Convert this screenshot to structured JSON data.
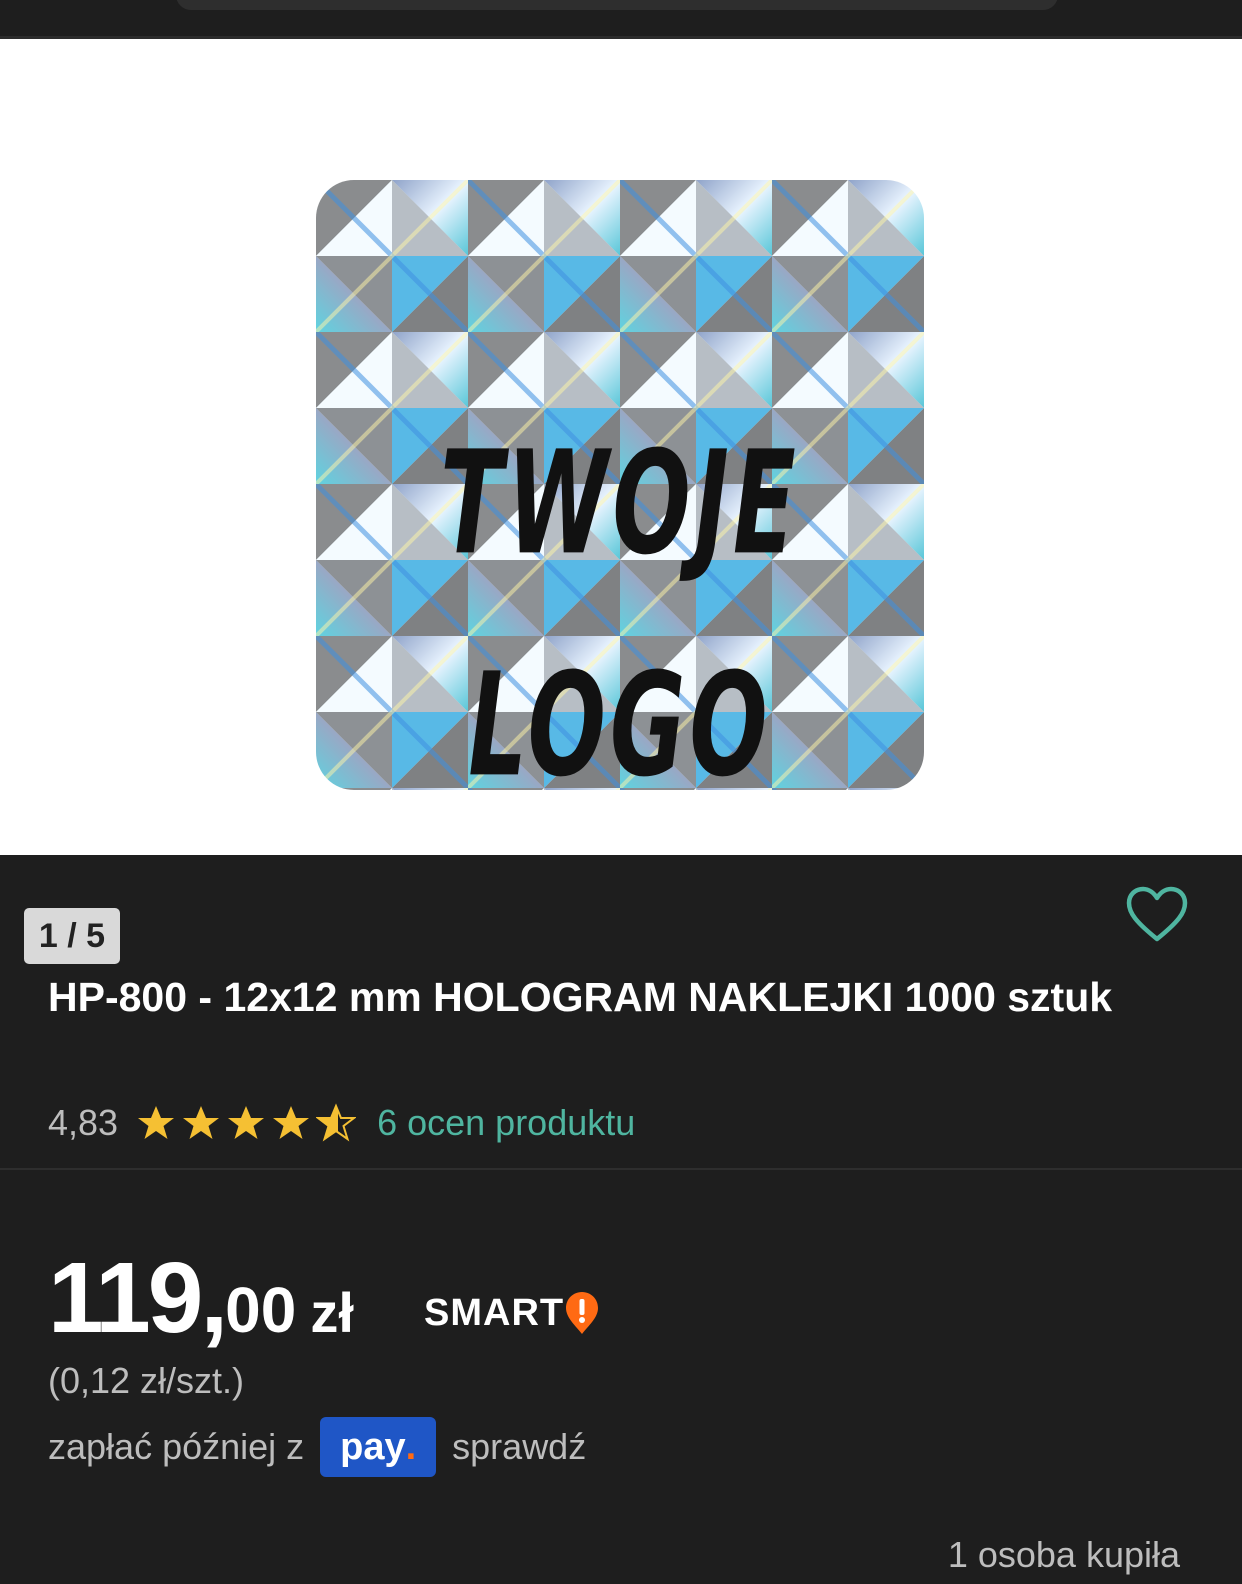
{
  "gallery": {
    "image_text_line1": "TWOJE",
    "image_text_line2": "LOGO",
    "counter": "1 / 5"
  },
  "product": {
    "title": "HP-800 - 12x12 mm HOLOGRAM NAKLEJKI 1000 sztuk",
    "rating_value": "4,83",
    "rating_stars": 4.83,
    "rating_link": "6 ocen produktu"
  },
  "price": {
    "integer": "119,",
    "decimal": "00",
    "currency": "zł",
    "smart_label": "SMART",
    "unit_price": "(0,12 zł/szt.)"
  },
  "paylater": {
    "prefix": "zapłać później z",
    "badge": "pay",
    "check": "sprawdź"
  },
  "buyers": {
    "text": "1 osoba kupiła"
  },
  "icons": {
    "favorite": "heart-outline-icon",
    "star": "star-icon",
    "smart": "smart-exclamation-icon"
  },
  "colors": {
    "accent": "#4fb5a0",
    "star": "#f5c033",
    "pay_blue": "#1f56c6",
    "pay_dot": "#ff6a13",
    "smart_orange": "#ff6a13"
  }
}
